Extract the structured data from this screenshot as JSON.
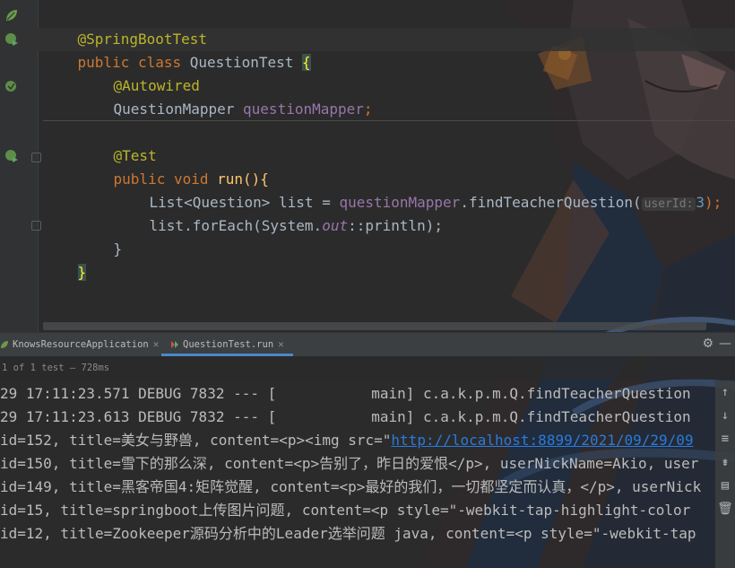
{
  "editor": {
    "lines": [
      {
        "id": "annotation-springboottest",
        "text": "@SpringBootTest"
      },
      {
        "id": "class-decl",
        "kw": "public class ",
        "name": "QuestionTest ",
        "brace": "{"
      },
      {
        "id": "annotation-autowired",
        "text": "@Autowired"
      },
      {
        "id": "field-decl",
        "type": "QuestionMapper ",
        "field": "questionMapper",
        "semi": ";"
      },
      {
        "id": "annotation-test",
        "text": "@Test"
      },
      {
        "id": "method-decl",
        "kw": "public void ",
        "name": "run(){"
      },
      {
        "id": "stmt-list",
        "p1": "List<Question> list = ",
        "field": "questionMapper",
        "p2": ".findTeacherQuestion(",
        "hint": "userId:",
        "num": "3",
        "p3": ");"
      },
      {
        "id": "stmt-foreach",
        "p1": "list.forEach(System.",
        "out": "out",
        "p2": "::println);"
      },
      {
        "id": "close-method",
        "text": "}"
      },
      {
        "id": "close-class",
        "text": "}"
      }
    ]
  },
  "run_panel": {
    "tabs": [
      {
        "label": "KnowsResourceApplication",
        "active": false
      },
      {
        "label": "QuestionTest.run",
        "active": true
      }
    ],
    "status": "1 of 1 test – 728ms",
    "console": [
      "29 17:11:23.571 DEBUG 7832 --- [           main] c.a.k.p.m.Q.findTeacherQuestion",
      "29 17:11:23.613 DEBUG 7832 --- [           main] c.a.k.p.m.Q.findTeacherQuestion",
      {
        "pre": "id=152, title=美女与野兽, content=<p><img src=\"",
        "link": "http://localhost:8899/2021/09/29/09"
      },
      "id=150, title=雪下的那么深, content=<p>告别了，昨日的爱恨</p>, userNickName=Akio, user",
      "id=149, title=黑客帝国4:矩阵觉醒, content=<p>最好的我们，一切都坚定而认真，</p>, userNick",
      "id=15, title=springboot上传图片问题, content=<p style=\"-webkit-tap-highlight-color",
      "id=12, title=Zookeeper源码分析中的Leader选举问题 java, content=<p style=\"-webkit-tap"
    ]
  },
  "icons": [
    "spring-leaf-icon",
    "run-gutter-icon",
    "bean-gutter-icon",
    "fold-icon",
    "gear-icon",
    "minimize-icon",
    "scroll-up-icon",
    "scroll-down-icon",
    "soft-wrap-icon",
    "print-icon",
    "trash-icon"
  ],
  "colors": {
    "background": "#2b2b2b",
    "keyword": "#cc7832",
    "annotation": "#bbb529",
    "field": "#9876aa",
    "number": "#6897bb",
    "link": "#287bde"
  }
}
